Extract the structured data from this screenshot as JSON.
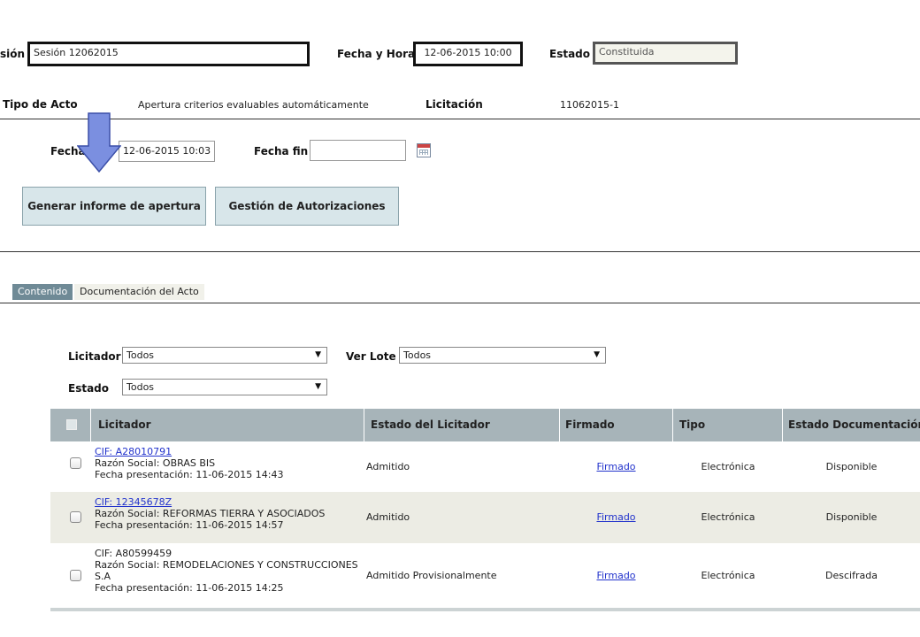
{
  "header": {
    "session_label": "sión",
    "session_value": "Sesión 12062015",
    "fecha_hora_label": "Fecha y Hora",
    "fecha_hora_value": "12-06-2015 10:00",
    "estado_label": "Estado",
    "estado_value": "Constituida",
    "tipo_acto_label": "Tipo de Acto",
    "tipo_acto_value": "Apertura criterios evaluables automáticamente",
    "licitacion_label": "Licitación",
    "licitacion_value": "11062015-1"
  },
  "dates": {
    "fecha_inicio_label": "Fecha",
    "fecha_inicio_value": "12-06-2015 10:03",
    "fecha_fin_label": "Fecha fin",
    "fecha_fin_value": "",
    "calendar_icon": "calendar-icon"
  },
  "buttons": {
    "generar": "Generar informe de apertura",
    "gestion": "Gestión de Autorizaciones"
  },
  "annotation": {
    "arrow_icon": "arrow-down-icon",
    "arrow_color": "#7b8fe0"
  },
  "tabs": [
    {
      "label": "Contenido",
      "active": true
    },
    {
      "label": "Documentación del Acto",
      "active": false
    }
  ],
  "filters": {
    "licitador_label": "Licitador",
    "licitador_value": "Todos",
    "ver_lote_label": "Ver Lote",
    "ver_lote_value": "Todos",
    "estado_label": "Estado",
    "estado_value": "Todos"
  },
  "table": {
    "columns": [
      "Licitador",
      "Estado del Licitador",
      "Firmado",
      "Tipo",
      "Estado Documentación"
    ],
    "rows": [
      {
        "cif": "CIF: A28010791",
        "cif_link": true,
        "razon": "Razón Social: OBRAS BIS",
        "razon_cont": "",
        "fecha": "Fecha presentación: 11-06-2015 14:43",
        "estado": "Admitido",
        "firmado": "Firmado",
        "tipo": "Electrónica",
        "estado_doc": "Disponible"
      },
      {
        "cif": "CIF: 12345678Z",
        "cif_link": true,
        "razon": "Razón Social: REFORMAS TIERRA Y ASOCIADOS",
        "razon_cont": "",
        "fecha": "Fecha presentación: 11-06-2015 14:57",
        "estado": "Admitido",
        "firmado": "Firmado",
        "tipo": "Electrónica",
        "estado_doc": "Disponible"
      },
      {
        "cif": "CIF: A80599459",
        "cif_link": false,
        "razon": "Razón Social: REMODELACIONES Y CONSTRUCCIONES",
        "razon_cont": "S.A",
        "fecha": "Fecha presentación: 11-06-2015 14:25",
        "estado": "Admitido Provisionalmente",
        "firmado": "Firmado",
        "tipo": "Electrónica",
        "estado_doc": "Descifrada"
      }
    ]
  },
  "colors": {
    "table_header": "#a7b4b9",
    "button_bg": "#d8e6ea",
    "tab_active": "#6f8a96",
    "link": "#2233cc"
  }
}
